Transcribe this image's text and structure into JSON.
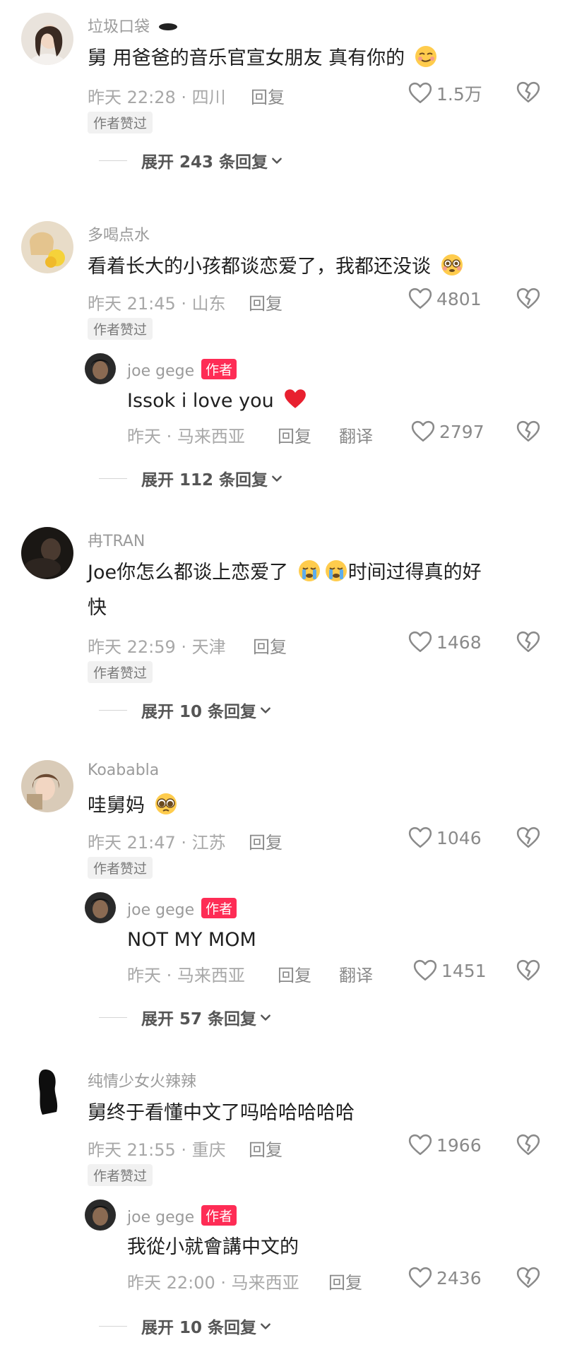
{
  "comments": [
    {
      "username": "垃圾口袋",
      "text": "舅 用爸爸的音乐官宣女朋友 真有你的",
      "time": "昨天 22:28 · 四川",
      "reply_label": "回复",
      "likes": "1.5万",
      "author_liked": "作者赞过",
      "expand": "展开 243 条回复"
    },
    {
      "username": "多喝点水",
      "text": "看着长大的小孩都谈恋爱了，我都还没谈",
      "time": "昨天 21:45 · 山东",
      "reply_label": "回复",
      "likes": "4801",
      "author_liked": "作者赞过",
      "reply": {
        "username": "joe gege",
        "tag": "作者",
        "text": "Issok i love you",
        "time": "昨天 · 马来西亚",
        "reply_label": "回复",
        "translate_label": "翻译",
        "likes": "2797"
      },
      "expand": "展开 112 条回复"
    },
    {
      "username": "冉TRAN",
      "text_line1": "Joe你怎么都谈上恋爱了",
      "text_line1b": "时间过得真的好",
      "text_line2": "快",
      "time": "昨天 22:59 · 天津",
      "reply_label": "回复",
      "likes": "1468",
      "author_liked": "作者赞过",
      "expand": "展开 10 条回复"
    },
    {
      "username": "Koababla",
      "text": "哇舅妈",
      "time": "昨天 21:47 · 江苏",
      "reply_label": "回复",
      "likes": "1046",
      "author_liked": "作者赞过",
      "reply": {
        "username": "joe gege",
        "tag": "作者",
        "text": "NOT MY MOM",
        "time": "昨天 · 马来西亚",
        "reply_label": "回复",
        "translate_label": "翻译",
        "likes": "1451"
      },
      "expand": "展开 57 条回复"
    },
    {
      "username": "纯情少女火辣辣",
      "text": "舅终于看懂中文了吗哈哈哈哈哈",
      "time": "昨天 21:55 · 重庆",
      "reply_label": "回复",
      "likes": "1966",
      "author_liked": "作者赞过",
      "reply": {
        "username": "joe gege",
        "tag": "作者",
        "text": "我從小就會講中文的",
        "time": "昨天 22:00 · 马来西亚",
        "reply_label": "回复",
        "likes": "2436"
      },
      "expand": "展开 10 条回复"
    }
  ],
  "colors": {
    "accent": "#fe2c55",
    "muted": "#a8a8a8",
    "text": "#1f1f1f"
  }
}
